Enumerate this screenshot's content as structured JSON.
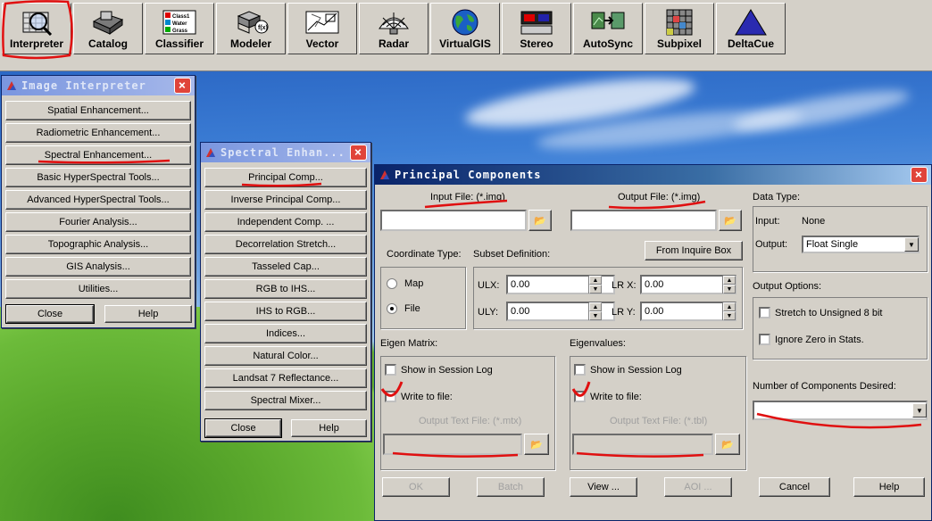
{
  "toolbar": {
    "buttons": [
      {
        "label": "Interpreter",
        "icon": "interpreter-icon"
      },
      {
        "label": "Catalog",
        "icon": "catalog-icon"
      },
      {
        "label": "Classifier",
        "icon": "classifier-icon"
      },
      {
        "label": "Modeler",
        "icon": "modeler-icon"
      },
      {
        "label": "Vector",
        "icon": "vector-icon"
      },
      {
        "label": "Radar",
        "icon": "radar-icon"
      },
      {
        "label": "VirtualGIS",
        "icon": "globe-icon"
      },
      {
        "label": "Stereo",
        "icon": "stereo-icon"
      },
      {
        "label": "AutoSync",
        "icon": "autosync-icon"
      },
      {
        "label": "Subpixel",
        "icon": "subpixel-icon"
      },
      {
        "label": "DeltaCue",
        "icon": "delta-icon"
      }
    ],
    "classifier_icon_text": [
      "Class1",
      "Water",
      "Grass"
    ]
  },
  "image_interpreter": {
    "title": "Image Interpreter",
    "items": [
      "Spatial Enhancement...",
      "Radiometric Enhancement...",
      "Spectral Enhancement...",
      "Basic HyperSpectral Tools...",
      "Advanced HyperSpectral Tools...",
      "Fourier Analysis...",
      "Topographic Analysis...",
      "GIS Analysis...",
      "Utilities..."
    ],
    "close": "Close",
    "help": "Help"
  },
  "spectral": {
    "title": "Spectral Enhan...",
    "items": [
      "Principal Comp...",
      "Inverse Principal Comp...",
      "Independent Comp. ...",
      "Decorrelation Stretch...",
      "Tasseled Cap...",
      "RGB to IHS...",
      "IHS to RGB...",
      "Indices...",
      "Natural Color...",
      "Landsat 7 Reflectance...",
      "Spectral Mixer..."
    ],
    "close": "Close",
    "help": "Help"
  },
  "pca": {
    "title": "Principal Components",
    "input_file_label": "Input File: (*.img)",
    "output_file_label": "Output File: (*.img)",
    "input_file_value": "",
    "output_file_value": "",
    "data_type_label": "Data Type:",
    "input_label": "Input:",
    "input_value": "None",
    "output_label": "Output:",
    "output_value": "Float Single",
    "coord_type_label": "Coordinate Type:",
    "subset_label": "Subset Definition:",
    "from_inquire": "From Inquire Box",
    "map_label": "Map",
    "file_label": "File",
    "ulx_label": "ULX:",
    "uly_label": "ULY:",
    "lrx_label": "LR X:",
    "lry_label": "LR Y:",
    "ulx": "0.00",
    "uly": "0.00",
    "lrx": "0.00",
    "lry": "0.00",
    "output_options_label": "Output Options:",
    "stretch_label": "Stretch to Unsigned 8 bit",
    "ignore_zero_label": "Ignore Zero in Stats.",
    "eigen_matrix_label": "Eigen Matrix:",
    "eigenvalues_label": "Eigenvalues:",
    "show_session_log": "Show in Session Log",
    "write_to_file": "Write to file:",
    "matrix_output_label": "Output Text File: (*.mtx)",
    "values_output_label": "Output Text File: (*.tbl)",
    "num_components_label": "Number of Components Desired:",
    "num_components_value": "",
    "ok": "OK",
    "batch": "Batch",
    "view": "View ...",
    "aoi": "AOI ...",
    "cancel": "Cancel",
    "help": "Help"
  },
  "colors": {
    "annotation": "#e01010",
    "titlebar": "#0a246a",
    "face": "#d4d0c8"
  }
}
